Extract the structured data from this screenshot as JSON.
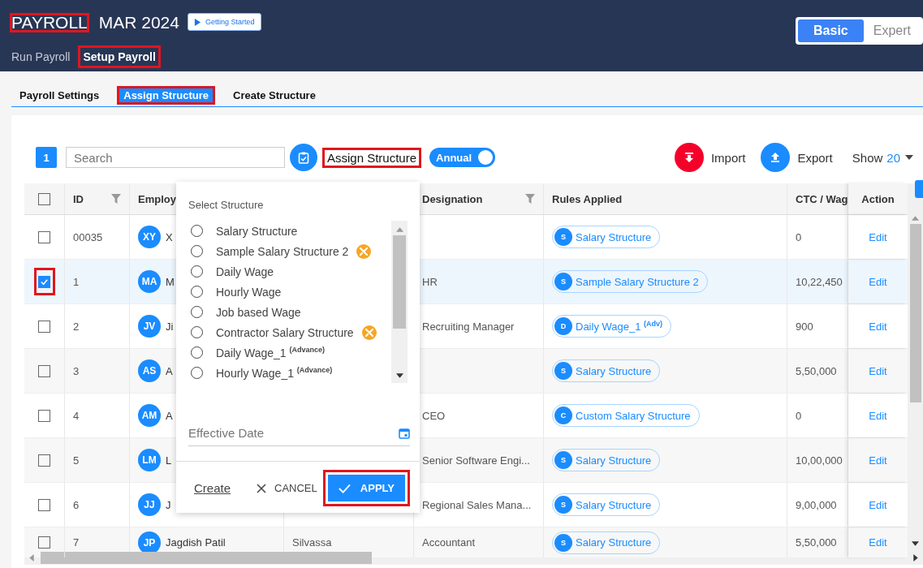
{
  "header": {
    "title": {
      "text": "PAYROLL",
      "highlighted": true
    },
    "period": "MAR 2024",
    "guide_button": "Getting Started",
    "modes": [
      {
        "label": "Basic",
        "selected": true
      },
      {
        "label": "Expert",
        "selected": false
      }
    ],
    "tabs": [
      {
        "label": "Run Payroll",
        "selected": false,
        "highlighted": false
      },
      {
        "label": "Setup Payroll",
        "selected": true,
        "highlighted": true
      }
    ]
  },
  "subtabs": [
    {
      "label": "Payroll Settings",
      "selected": false,
      "highlighted": false
    },
    {
      "label": "Assign Structure",
      "selected": true,
      "highlighted": true
    },
    {
      "label": "Create Structure",
      "selected": false,
      "highlighted": false
    }
  ],
  "toolbar": {
    "selected_count": "1",
    "search": {
      "placeholder": "Search"
    },
    "assign_label": {
      "text": "Assign Structure",
      "highlighted": true
    },
    "annual_toggle": {
      "label": "Annual",
      "on": true
    },
    "import": "Import",
    "export": "Export",
    "show_label": "Show",
    "show_value": "20"
  },
  "table": {
    "all_checked": false,
    "columns": [
      "ID",
      "Employ",
      "Designation",
      "Rules Applied",
      "CTC / Wag",
      "Action"
    ],
    "rows": [
      {
        "id": "00035",
        "initials": "XY",
        "name": "X",
        "column_4": "",
        "designation": "",
        "rule_letter": "S",
        "rule": "Salary Structure",
        "ctc": "0",
        "action": "Edit",
        "checked": false,
        "highlighted": false
      },
      {
        "id": "1",
        "initials": "MA",
        "name": "M",
        "column_4": "",
        "designation": "HR",
        "rule_letter": "S",
        "rule": "Sample Salary Structure 2",
        "ctc": "10,22,450",
        "action": "Edit",
        "checked": true,
        "highlighted": true
      },
      {
        "id": "2",
        "initials": "JV",
        "name": "Ji",
        "column_4": "",
        "designation": "Recruiting Manager",
        "rule_letter": "D",
        "rule": "Daily Wage_1 $^{(Adv)}$",
        "ctc": "900",
        "action": "Edit",
        "checked": false,
        "highlighted": false
      },
      {
        "id": "3",
        "initials": "AS",
        "name": "A",
        "column_4": "",
        "designation": "",
        "rule_letter": "S",
        "rule": "Salary Structure",
        "ctc": "5,50,000",
        "action": "Edit",
        "checked": false,
        "highlighted": false
      },
      {
        "id": "4",
        "initials": "AM",
        "name": "A",
        "column_4": "",
        "designation": "CEO",
        "rule_letter": "C",
        "rule": "Custom Salary Structure",
        "ctc": "0",
        "action": "Edit",
        "checked": false,
        "highlighted": false
      },
      {
        "id": "5",
        "initials": "LM",
        "name": "L",
        "column_4": "",
        "designation": "Senior Software Engi...",
        "rule_letter": "S",
        "rule": "Salary Structure",
        "ctc": "10,00,000",
        "action": "Edit",
        "checked": false,
        "highlighted": false
      },
      {
        "id": "6",
        "initials": "JJ",
        "name": "J",
        "column_4": "",
        "designation": "Regional Sales Mana...",
        "rule_letter": "S",
        "rule": "Salary Structure",
        "ctc": "9,00,000",
        "action": "Edit",
        "checked": false,
        "highlighted": false
      },
      {
        "id": "7",
        "initials": "JP",
        "name": "Jagdish Patil",
        "column_4": "Silvassa",
        "designation": "Accountant",
        "rule_letter": "S",
        "rule": "Salary Structure",
        "ctc": "5,50,000",
        "action": "Edit",
        "checked": false,
        "highlighted": false
      }
    ]
  },
  "popup": {
    "title": "Select Structure",
    "options": [
      {
        "label": "Salary Structure",
        "selected": false,
        "badge": false
      },
      {
        "label": "Sample Salary Structure 2",
        "selected": false,
        "badge": true
      },
      {
        "label": "Daily Wage",
        "selected": false,
        "badge": false
      },
      {
        "label": "Hourly Wage",
        "selected": false,
        "badge": false
      },
      {
        "label": "Job based Wage",
        "selected": false,
        "badge": false
      },
      {
        "label": "Contractor Salary Structure",
        "selected": false,
        "badge": true
      },
      {
        "label": "Daily Wage_1 $^{(Advance)}$",
        "selected": false,
        "badge": false
      },
      {
        "label": "Hourly Wage_1 $^{(Advance)}$",
        "selected": false,
        "badge": false
      }
    ],
    "date_field": {
      "placeholder": "Effective Date"
    },
    "create_link": "Create",
    "cancel_button": "CANCEL",
    "apply_button": {
      "text": "APPLY",
      "highlighted": true
    }
  }
}
